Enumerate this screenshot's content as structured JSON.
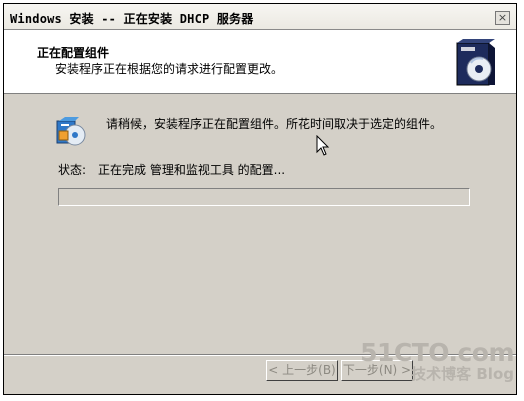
{
  "window": {
    "title": "Windows 安装 -- 正在安装 DHCP 服务器",
    "close_glyph": "×"
  },
  "header": {
    "title": "正在配置组件",
    "subtitle": "安装程序正在根据您的请求进行配置更改。",
    "icon": "install-box-cd-icon"
  },
  "message": {
    "icon": "setup-components-icon",
    "text": "请稍候，安装程序正在配置组件。所花时间取决于选定的组件。"
  },
  "status": {
    "label": "状态:",
    "text": "正在完成 管理和监视工具 的配置..."
  },
  "progress": {
    "value": 0
  },
  "buttons": {
    "back": "< 上一步(B)",
    "next": "下一步(N) >"
  },
  "watermark": {
    "site": "51CTO.com",
    "caption": "技术博客  Blog"
  },
  "colors": {
    "dialog_bg": "#d4d0c8",
    "header_bg": "#ffffff",
    "disabled_text": "#8d8a82"
  }
}
